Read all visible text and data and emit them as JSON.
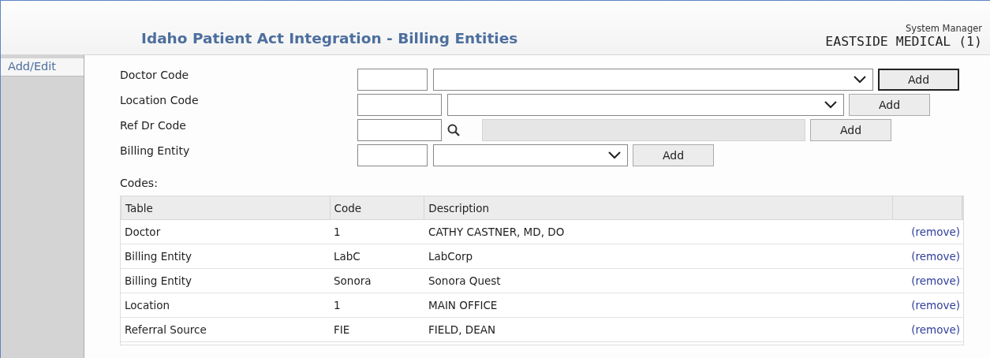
{
  "header": {
    "title": "Idaho Patient Act Integration - Billing Entities",
    "user_role": "System Manager",
    "practice": "EASTSIDE MEDICAL (1)"
  },
  "sidebar": {
    "tabs": [
      {
        "label": "Add/Edit",
        "selected": true
      }
    ]
  },
  "form": {
    "rows": [
      {
        "label": "Doctor Code",
        "kind": "select",
        "button": "Add",
        "focused": true
      },
      {
        "label": "Location Code",
        "kind": "select",
        "button": "Add",
        "focused": false
      },
      {
        "label": "Ref Dr Code",
        "kind": "search",
        "button": "Add",
        "focused": false
      },
      {
        "label": "Billing Entity",
        "kind": "select",
        "button": "Add",
        "focused": false
      }
    ]
  },
  "codes": {
    "label": "Codes:",
    "columns": [
      "Table",
      "Code",
      "Description"
    ],
    "rows": [
      {
        "table": "Doctor",
        "code": "1",
        "description": "CATHY CASTNER, MD, DO",
        "action": "(remove)"
      },
      {
        "table": "Billing Entity",
        "code": "LabC",
        "description": "LabCorp",
        "action": "(remove)"
      },
      {
        "table": "Billing Entity",
        "code": "Sonora",
        "description": "Sonora Quest",
        "action": "(remove)"
      },
      {
        "table": "Location",
        "code": "1",
        "description": "MAIN OFFICE",
        "action": "(remove)"
      },
      {
        "table": "Referral Source",
        "code": "FIE",
        "description": "FIELD, DEAN",
        "action": "(remove)"
      }
    ]
  }
}
